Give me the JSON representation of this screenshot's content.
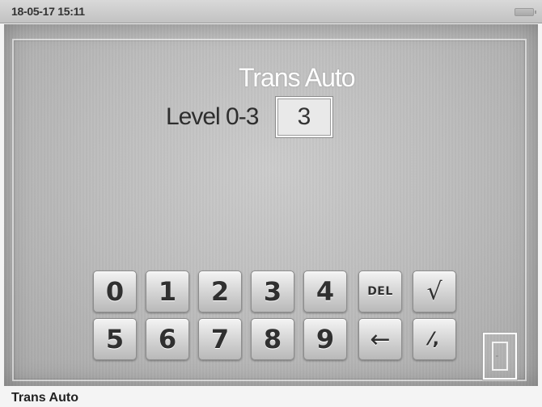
{
  "status_bar": {
    "datetime": "18-05-17 15:11"
  },
  "dialog": {
    "title": "Trans Auto",
    "level_label": "Level 0-3",
    "level_value": "3"
  },
  "keypad": {
    "row1": [
      "0",
      "1",
      "2",
      "3",
      "4",
      "DEL",
      "√"
    ],
    "row2": [
      "5",
      "6",
      "7",
      "8",
      "9",
      "←",
      "⁄,"
    ]
  },
  "icons": {
    "battery": "battery-icon",
    "exit": "door-exit-icon"
  },
  "footer": {
    "label": "Trans Auto"
  }
}
